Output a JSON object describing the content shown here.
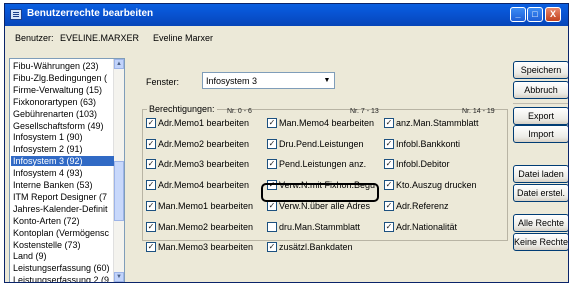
{
  "window": {
    "title": "Benutzerrechte bearbeiten",
    "controls": {
      "minimize": "_",
      "maximize": "□",
      "close": "X"
    }
  },
  "user": {
    "label": "Benutzer:",
    "login": "EVELINE.MARXER",
    "name": "Eveline Marxer"
  },
  "list": {
    "items": [
      "Fibu-Währungen (23)",
      "Fibu-Zlg.Bedingungen (",
      "Firme-Verwaltung (15)",
      "Fixkonorartypen (63)",
      "Gebührenarten (103)",
      "Gesellschaftsform (49)",
      "Infosystem 1 (90)",
      "Infosystem 2 (91)",
      "Infosystem 3 (92)",
      "Infosystem 4 (93)",
      "Interne Banken (53)",
      "ITM Report Designer (7",
      "Jahres-Kalender-Definit",
      "Konto-Arten (72)",
      "Kontoplan (Vermögensc",
      "Kostenstelle (73)",
      "Land (9)",
      "Leistungserfassung (60)",
      "Leistungserfassung 2 (9"
    ],
    "selected_index": 8
  },
  "fenster": {
    "label": "Fenster:",
    "value": "Infosystem 3"
  },
  "permissions": {
    "group_label": "Berechtigungen:",
    "ranges": [
      "Nr. 0 - 6",
      "Nr. 7 - 13",
      "Nr. 14 - 19"
    ],
    "col1": [
      {
        "label": "Adr.Memo1 bearbeiten",
        "checked": true
      },
      {
        "label": "Adr.Memo2 bearbeiten",
        "checked": true
      },
      {
        "label": "Adr.Memo3 bearbeiten",
        "checked": true
      },
      {
        "label": "Adr.Memo4 bearbeiten",
        "checked": true
      },
      {
        "label": "Man.Memo1 bearbeiten",
        "checked": true
      },
      {
        "label": "Man.Memo2 bearbeiten",
        "checked": true
      },
      {
        "label": "Man.Memo3 bearbeiten",
        "checked": true
      }
    ],
    "col2": [
      {
        "label": "Man.Memo4 bearbeiten",
        "checked": true
      },
      {
        "label": "Dru.Pend.Leistungen",
        "checked": true
      },
      {
        "label": "Pend.Leistungen anz.",
        "checked": true
      },
      {
        "label": "Verw.N.mit Fixhon.Begu",
        "checked": true
      },
      {
        "label": "Verw.N.über alle Adres",
        "checked": true
      },
      {
        "label": "dru.Man.Stammblatt",
        "checked": false
      },
      {
        "label": "zusätzl.Bankdaten",
        "checked": true
      }
    ],
    "col3": [
      {
        "label": "anz.Man.Stammblatt",
        "checked": true
      },
      {
        "label": "Infobl.Bankkonti",
        "checked": true
      },
      {
        "label": "Infobl.Debitor",
        "checked": true
      },
      {
        "label": "Kto.Auszug drucken",
        "checked": true
      },
      {
        "label": "Adr.Referenz",
        "checked": true
      },
      {
        "label": "Adr.Nationalität",
        "checked": true
      }
    ]
  },
  "buttons": {
    "save": "Speichern",
    "cancel": "Abbruch",
    "export": "Export",
    "import": "Import",
    "datei_laden": "Datei laden",
    "datei_erstel": "Datei erstel.",
    "alle_rechte": "Alle Rechte",
    "keine_rechte": "Keine Rechte"
  }
}
